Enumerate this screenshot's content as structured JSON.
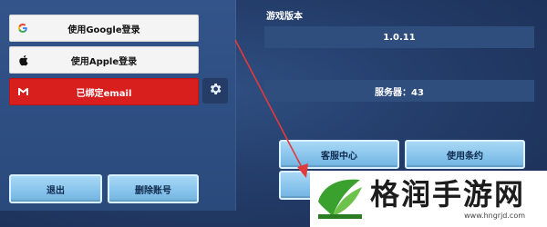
{
  "login": {
    "google_label": "使用Google登录",
    "apple_label": "使用Apple登录",
    "email_label": "已绑定email"
  },
  "bottom_left": {
    "logout_label": "退出",
    "delete_label": "删除账号"
  },
  "game_version": {
    "title": "游戏版本",
    "value": "1.0.11"
  },
  "server": {
    "label": "服务器：43"
  },
  "actions": {
    "support_label": "客服中心",
    "terms_label": "使用条约"
  },
  "watermark": {
    "name": "格润手游网",
    "url": "www.hngrjd.com"
  },
  "colors": {
    "background": "#223a66",
    "email_red": "#d91e1e",
    "button_blue": "#86c3ec",
    "watermark_green": "#3aa12f"
  },
  "icons": [
    "google-icon",
    "apple-icon",
    "gmail-icon",
    "gear-icon",
    "arrow-icon"
  ]
}
